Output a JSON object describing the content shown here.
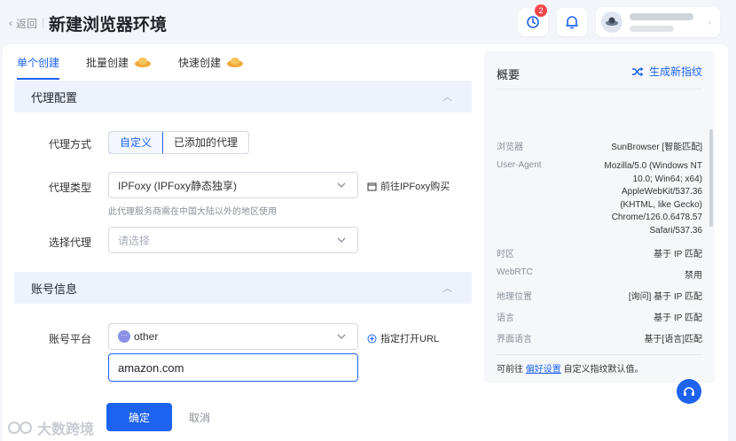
{
  "header": {
    "back_label": "返回",
    "title": "新建浏览器环境",
    "notification_count": "2"
  },
  "tabs": [
    {
      "label": "单个创建"
    },
    {
      "label": "批量创建"
    },
    {
      "label": "快速创建"
    }
  ],
  "proxy": {
    "section_title": "代理配置",
    "method_label": "代理方式",
    "method_options": [
      "自定义",
      "已添加的代理"
    ],
    "type_label": "代理类型",
    "type_value": "IPFoxy (IPFoxy静态独享)",
    "buy_link": "前往IPFoxy购买",
    "type_hint": "此代理服务商需在中国大陆以外的地区使用",
    "select_label": "选择代理",
    "select_placeholder": "请选择"
  },
  "account": {
    "section_title": "账号信息",
    "platform_label": "账号平台",
    "platform_icon_text": "···",
    "platform_value": "other",
    "open_url_link": "指定打开URL",
    "url_value": "amazon.com"
  },
  "overview": {
    "title": "概要",
    "generate_label": "生成新指纹",
    "rows": [
      {
        "key": "浏览器",
        "value": "SunBrowser [智能匹配]"
      },
      {
        "key": "User-Agent",
        "value": "Mozilla/5.0 (Windows NT 10.0; Win64; x64) AppleWebKit/537.36 (KHTML, like Gecko) Chrome/126.0.6478.57 Safari/537.36"
      },
      {
        "key": "时区",
        "value": "基于 IP 匹配"
      },
      {
        "key": "WebRTC",
        "value": "禁用"
      },
      {
        "key": "地理位置",
        "value": "[询问] 基于 IP 匹配"
      },
      {
        "key": "语言",
        "value": "基于 IP 匹配"
      },
      {
        "key": "界面语言",
        "value": "基于[语言]匹配"
      }
    ],
    "footer_prefix": "可前往",
    "footer_link": "偏好设置",
    "footer_suffix": "自定义指纹默认值。"
  },
  "actions": {
    "confirm": "确定",
    "cancel": "取消"
  },
  "watermark": "大数跨境",
  "colors": {
    "primary": "#1d63ef",
    "section_bg": "#eef2fc",
    "badge": "#f5484b"
  }
}
